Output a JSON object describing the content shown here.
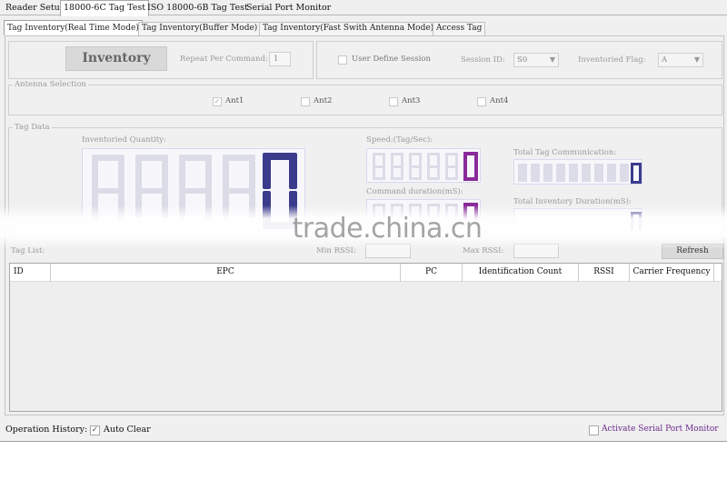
{
  "top_tabs": [
    {
      "label": "Reader Setup",
      "active": false
    },
    {
      "label": "18000-6C Tag Test",
      "active": true
    },
    {
      "label": "ISO 18000-6B Tag Test",
      "active": false
    },
    {
      "label": "Serial Port Monitor",
      "active": false
    }
  ],
  "sub_tabs": [
    {
      "label": "Tag Inventory(Real Time Mode)",
      "active": true
    },
    {
      "label": "Tag Inventory(Buffer Mode)",
      "active": false
    },
    {
      "label": "Tag Inventory(Fast Swith Antenna Mode)",
      "active": false
    },
    {
      "label": "Access Tag",
      "active": false
    }
  ],
  "inventory": {
    "button_label": "Inventory",
    "repeat_label": "Repeat Per Command:",
    "repeat_value": "1",
    "user_define_session_label": "User Define Session",
    "user_define_session_checked": false,
    "session_id_label": "Session ID:",
    "session_id_value": "S0",
    "inventoried_flag_label": "Inventoried Flag:",
    "inventoried_flag_value": "A"
  },
  "antenna": {
    "legend": "Antenna Selection",
    "items": [
      {
        "label": "Ant1",
        "checked": true
      },
      {
        "label": "Ant2",
        "checked": false
      },
      {
        "label": "Ant3",
        "checked": false
      },
      {
        "label": "Ant4",
        "checked": false
      }
    ]
  },
  "tag_data": {
    "legend": "Tag Data",
    "inventoried_quantity_label": "Inventoried Quantity:",
    "inventoried_quantity_value": "0",
    "speed_label": "Speed:(Tag/Sec):",
    "speed_value": "0",
    "command_duration_label": "Command duration(mS):",
    "command_duration_value": "0",
    "total_tag_communication_label": "Total Tag Communication:",
    "total_tag_communication_value": "0",
    "total_inventory_duration_label": "Total Inventory Duration(mS):",
    "total_inventory_duration_value": "0"
  },
  "tag_list": {
    "label": "Tag List:",
    "min_rssi_label": "Min RSSI:",
    "min_rssi_value": "",
    "max_rssi_label": "Max RSSI:",
    "max_rssi_value": "",
    "refresh_label": "Refresh",
    "columns": [
      "ID",
      "EPC",
      "PC",
      "Identification Count",
      "RSSI",
      "Carrier Frequency"
    ]
  },
  "footer": {
    "operation_history_label": "Operation History:",
    "auto_clear_label": "Auto Clear",
    "auto_clear_checked": true,
    "activate_monitor_label": "Activate Serial Port Monitor",
    "activate_monitor_checked": false
  },
  "watermark": "trade.china.cn",
  "colors": {
    "lcd_lit": "#3b3b8c",
    "lcd_lit_purple": "#8a2a9a",
    "lcd_ghost": "#dcdce8",
    "activate_link": "#6a2a8a"
  }
}
